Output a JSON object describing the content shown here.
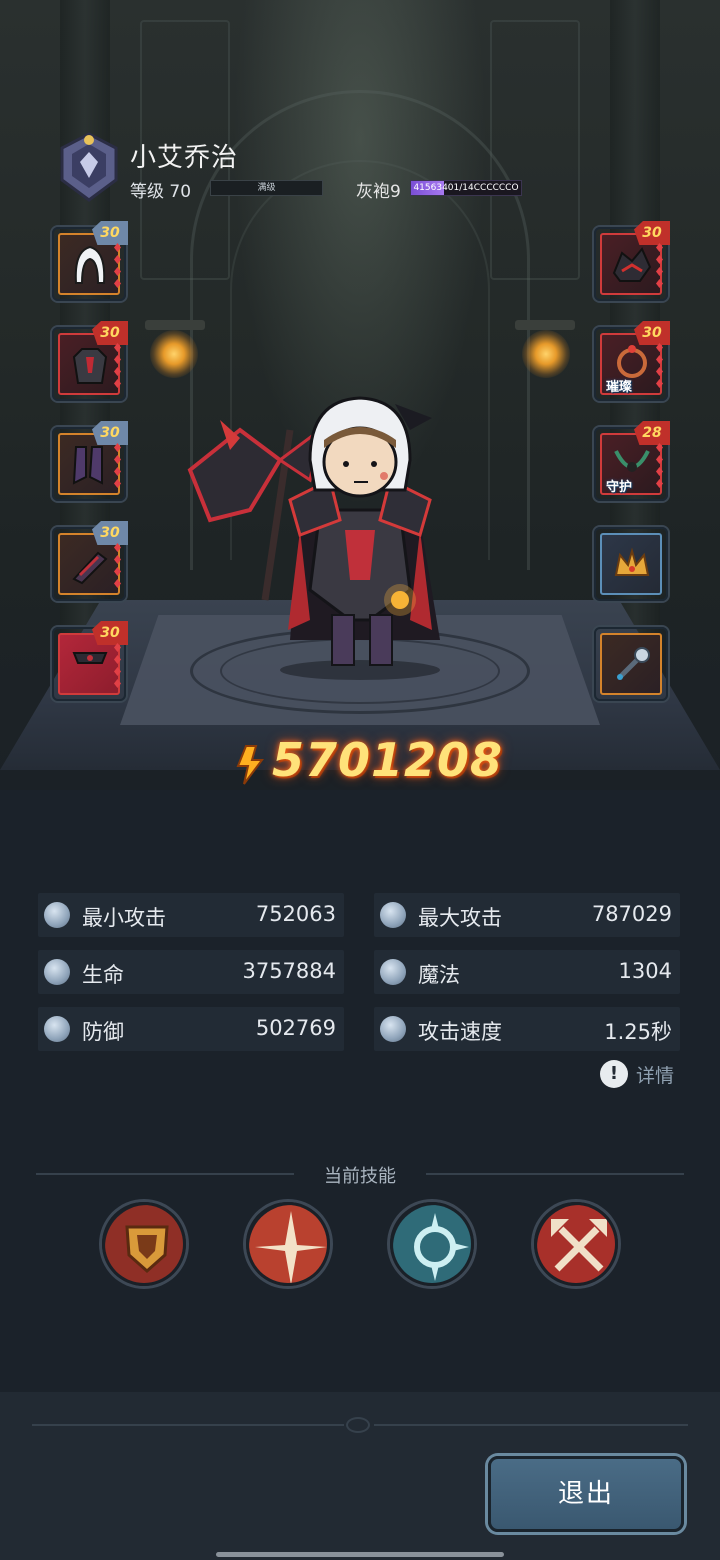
{
  "player": {
    "name": "小艾乔治",
    "level_label": "等级 70",
    "level_bar_text": "满级",
    "rank_label": "灰袍9",
    "rank_progress_text": "41563401/14CCCCCCO",
    "rank_progress_fraction": 0.3
  },
  "equipment": {
    "left": [
      {
        "level": "30",
        "badge": "blue",
        "frame": "orange",
        "icon": "hood-icon"
      },
      {
        "level": "30",
        "badge": "red",
        "frame": "red",
        "icon": "armor-icon"
      },
      {
        "level": "30",
        "badge": "blue",
        "frame": "orange",
        "icon": "boots-icon"
      },
      {
        "level": "30",
        "badge": "blue",
        "frame": "orange",
        "icon": "bracer-icon"
      },
      {
        "level": "30",
        "badge": "red",
        "frame": "redfill",
        "icon": "belt-icon"
      }
    ],
    "right": [
      {
        "level": "30",
        "badge": "red",
        "frame": "red",
        "icon": "pauldron-icon",
        "tag": ""
      },
      {
        "level": "30",
        "badge": "red",
        "frame": "red",
        "icon": "ring-icon",
        "tag": "璀璨"
      },
      {
        "level": "28",
        "badge": "red",
        "frame": "red",
        "icon": "necklace-icon",
        "tag": "守护"
      },
      {
        "level": "",
        "badge": "",
        "frame": "blue",
        "icon": "crown-icon",
        "tag": ""
      },
      {
        "level": "",
        "badge": "",
        "frame": "orange",
        "icon": "mace-icon",
        "tag": ""
      }
    ]
  },
  "power": {
    "value": "5701208"
  },
  "stats": [
    {
      "label": "最小攻击",
      "value": "752063",
      "icon": "sword-icon"
    },
    {
      "label": "最大攻击",
      "value": "787029",
      "icon": "sword-icon"
    },
    {
      "label": "生命",
      "value": "3757884",
      "icon": "heart-icon"
    },
    {
      "label": "魔法",
      "value": "1304",
      "icon": "magic-icon"
    },
    {
      "label": "防御",
      "value": "502769",
      "icon": "shield-icon"
    },
    {
      "label": "攻击速度",
      "value": "1.25秒",
      "icon": "speed-icon"
    }
  ],
  "detail_label": "详情",
  "skills": {
    "title": "当前技能",
    "items": [
      {
        "icon": "shield-crest-skill-icon",
        "color": "#a33a2c"
      },
      {
        "icon": "slash-burst-skill-icon",
        "color": "#c04a3a"
      },
      {
        "icon": "vortex-skill-icon",
        "color": "#3d7d8c"
      },
      {
        "icon": "crossed-axes-skill-icon",
        "color": "#b3352e"
      }
    ]
  },
  "exit_label": "退出",
  "colors": {
    "power_text": "#ffe27a",
    "background": "#1b222a",
    "accent_button": "#4a6c86"
  }
}
